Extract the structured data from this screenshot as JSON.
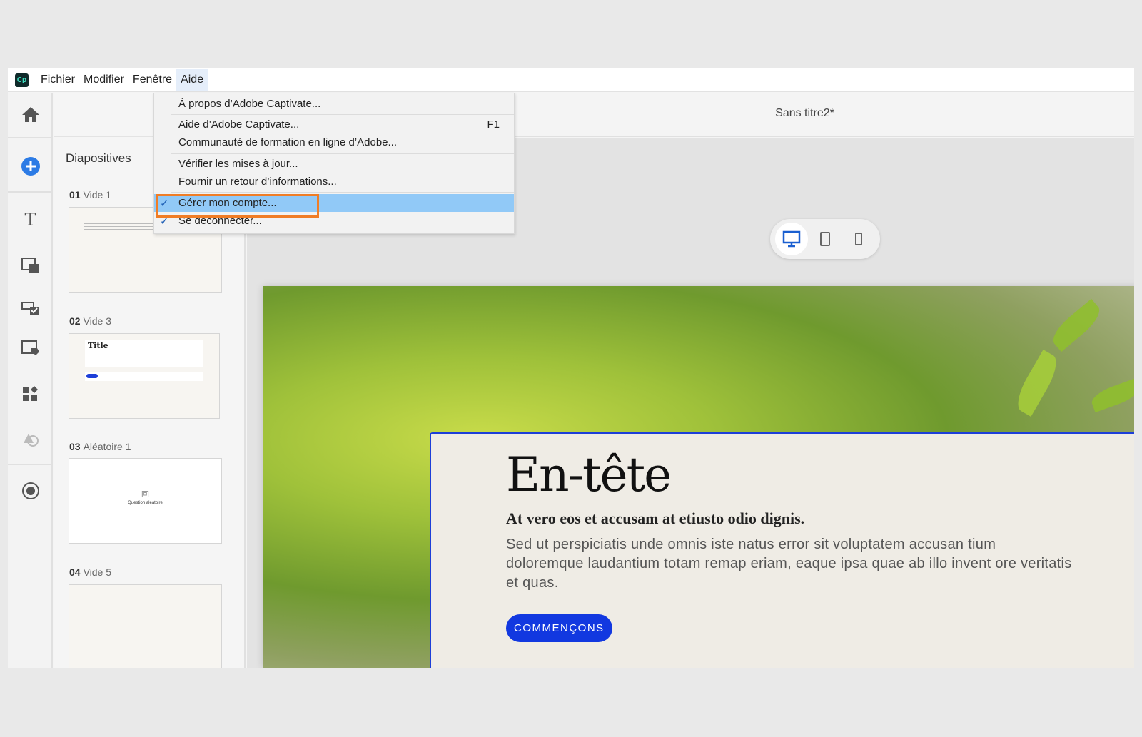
{
  "menubar": {
    "logo": "Cp",
    "items": [
      "Fichier",
      "Modifier",
      "Fenêtre",
      "Aide"
    ]
  },
  "header": {
    "title": "Sans titre2*"
  },
  "toolbar": {
    "icons": [
      "home-icon",
      "add-icon",
      "text-icon",
      "media-icon",
      "quiz-icon",
      "interactions-icon",
      "widgets-icon",
      "shapes-icon",
      "record-icon"
    ]
  },
  "slides": {
    "title": "Diapositives",
    "items": [
      {
        "num": "01",
        "name": "Vide 1",
        "thumb_title": "TITRE"
      },
      {
        "num": "02",
        "name": "Vide 3",
        "thumb_title": "Title"
      },
      {
        "num": "03",
        "name": "Aléatoire 1",
        "thumb_title": "Question aléatoire"
      },
      {
        "num": "04",
        "name": "Vide 5"
      }
    ]
  },
  "devices": [
    "desktop",
    "tablet",
    "mobile"
  ],
  "slide": {
    "heading": "En-tête",
    "subheading": "At vero eos et accusam at etiusto odio dignis.",
    "body": "Sed ut perspiciatis unde omnis iste natus error sit voluptatem accusan tium doloremque laudantium totam remap eriam, eaque ipsa quae ab illo invent ore veritatis et quas.",
    "cta": "COMMENÇONS"
  },
  "help_menu": {
    "items": [
      {
        "label": "À propos d’Adobe Captivate..."
      },
      {
        "label": "Aide d’Adobe Captivate...",
        "shortcut": "F1"
      },
      {
        "label": "Communauté de formation en ligne d’Adobe..."
      },
      {
        "label": "Vérifier les mises à jour..."
      },
      {
        "label": "Fournir un retour d’informations..."
      },
      {
        "label": "Gérer mon compte...",
        "checked": true,
        "highlighted": true
      },
      {
        "label": "Se déconnecter...",
        "checked": true
      }
    ],
    "check": "✓"
  },
  "colors": {
    "accent": "#1238e0",
    "highlight": "#91c9f7",
    "callout": "#f07d26"
  }
}
